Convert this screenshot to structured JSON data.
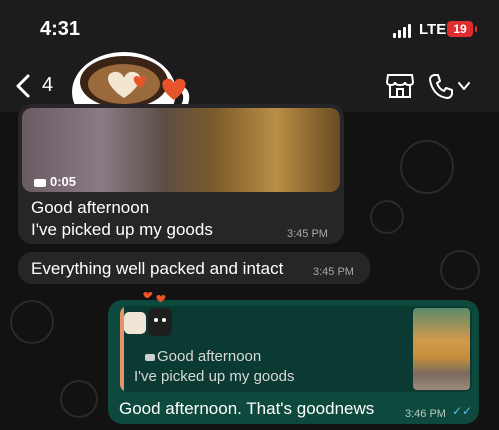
{
  "status_bar": {
    "time": "4:31",
    "network": "LTE",
    "battery": "19"
  },
  "header": {
    "unread_count": "4",
    "icons": [
      "back-icon",
      "shop-icon",
      "call-icon",
      "chevron-down-icon"
    ]
  },
  "messages": [
    {
      "type": "video",
      "duration": "0:05",
      "lines": [
        "Good afternoon",
        "I've picked up my goods"
      ],
      "time": "3:45 PM"
    },
    {
      "type": "text",
      "text": "Everything well packed and intact",
      "time": "3:45 PM"
    }
  ],
  "reply": {
    "quoted_lines": [
      "Good afternoon",
      "I've picked up my goods"
    ],
    "text": "Good afternoon. That's goodnews",
    "time": "3:46 PM",
    "status": "read"
  },
  "colors": {
    "outgoing_bubble": "#0d4a3d",
    "incoming_bubble": "#262628",
    "quote_bar": "#e6936b",
    "read_ticks": "#53bdeb"
  }
}
